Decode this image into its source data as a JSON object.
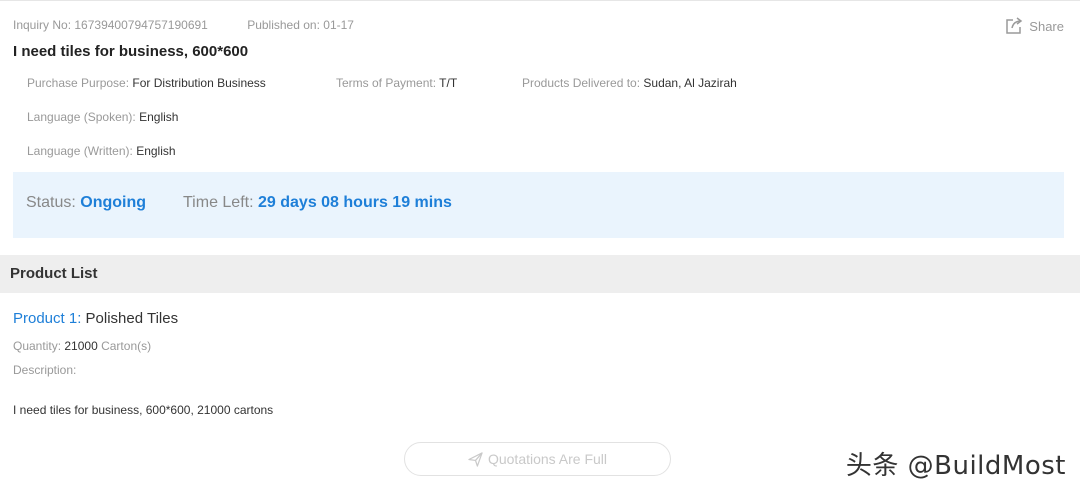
{
  "inquiry": {
    "number_label": "Inquiry No:",
    "number_value": "16739400794757190691",
    "published_label": "Published on:",
    "published_value": "01-17",
    "share_label": "Share",
    "title": "I need tiles for business, 600*600"
  },
  "details": {
    "purpose_label": "Purchase Purpose:",
    "purpose_value": "For Distribution Business",
    "payment_label": "Terms of Payment:",
    "payment_value": "T/T",
    "delivered_label": "Products Delivered to:",
    "delivered_value": "Sudan, Al Jazirah",
    "spoken_label": "Language (Spoken):",
    "spoken_value": "English",
    "written_label": "Language (Written):",
    "written_value": "English"
  },
  "status": {
    "status_label": "Status:",
    "status_value": "Ongoing",
    "time_label": "Time Left:",
    "time_value": "29 days 08 hours 19 mins"
  },
  "product_list": {
    "heading": "Product List",
    "items": [
      {
        "index_label": "Product 1:",
        "name": "Polished Tiles",
        "quantity_label": "Quantity:",
        "quantity_value": "21000",
        "quantity_unit": "Carton(s)",
        "description_label": "Description:",
        "description_text": "I need tiles for business, 600*600, 21000 cartons"
      }
    ]
  },
  "actions": {
    "quote_button_label": "Quotations Are Full"
  },
  "watermark": "头条 @BuildMost",
  "icons": {
    "share": "share-icon",
    "send": "send-icon"
  },
  "colors": {
    "accent": "#1e7fd8",
    "status_bg": "#eaf4fd",
    "section_bg": "#eeeeee"
  }
}
